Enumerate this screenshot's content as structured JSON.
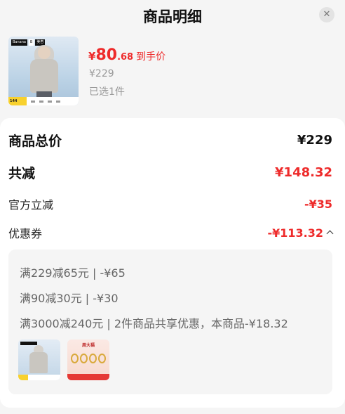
{
  "header": {
    "title": "商品明细",
    "close_icon": "close-icon"
  },
  "product": {
    "image_brand_tags": [
      "Banana",
      "B",
      "美杏"
    ],
    "image_strip_text": "144",
    "price_currency": "¥",
    "price_integer": "80",
    "price_decimal": ".68",
    "price_tag": "到手价",
    "original_price": "¥229",
    "selected_qty": "已选1件"
  },
  "summary": {
    "total_label": "商品总价",
    "total_value": "¥229",
    "reduction_label": "共减",
    "reduction_value": "¥148.32",
    "official_label": "官方立减",
    "official_value": "-¥35",
    "coupon_label": "优惠券",
    "coupon_value": "-¥113.32"
  },
  "coupons": {
    "lines": [
      "满229减65元 | -¥65",
      "满90减30元 | -¥30",
      "满3000减240元 | 2件商品共享优惠，本商品-¥18.32"
    ],
    "thumb2_header": "周大福"
  },
  "colors": {
    "accent_red": "#ee2b2b",
    "page_bg": "#f5f5f5",
    "card_bg": "#ffffff"
  }
}
